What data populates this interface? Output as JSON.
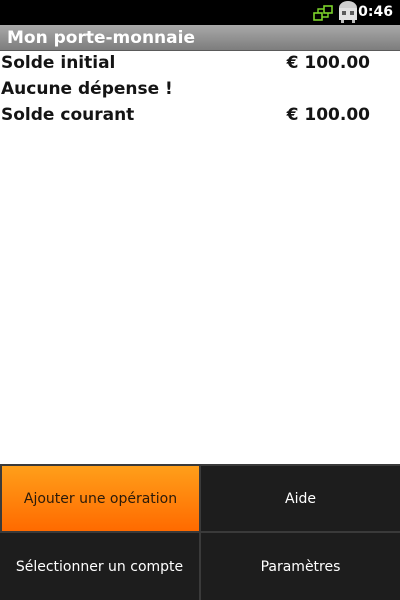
{
  "status_bar": {
    "time": "0:46",
    "icons": [
      "network-sync-icon",
      "usb-connected-icon"
    ]
  },
  "app": {
    "title": "Mon porte-monnaie"
  },
  "summary": {
    "rows": [
      {
        "label": "Solde initial",
        "value": "€ 100.00"
      },
      {
        "label": "Aucune dépense !",
        "value": ""
      },
      {
        "label": "Solde courant",
        "value": "€ 100.00"
      }
    ]
  },
  "menu": {
    "items": [
      {
        "label": "Ajouter une opération",
        "selected": true
      },
      {
        "label": "Aide",
        "selected": false
      },
      {
        "label": "Sélectionner un compte",
        "selected": false
      },
      {
        "label": "Paramètres",
        "selected": false
      }
    ],
    "highlight_color": "#ff8000"
  }
}
